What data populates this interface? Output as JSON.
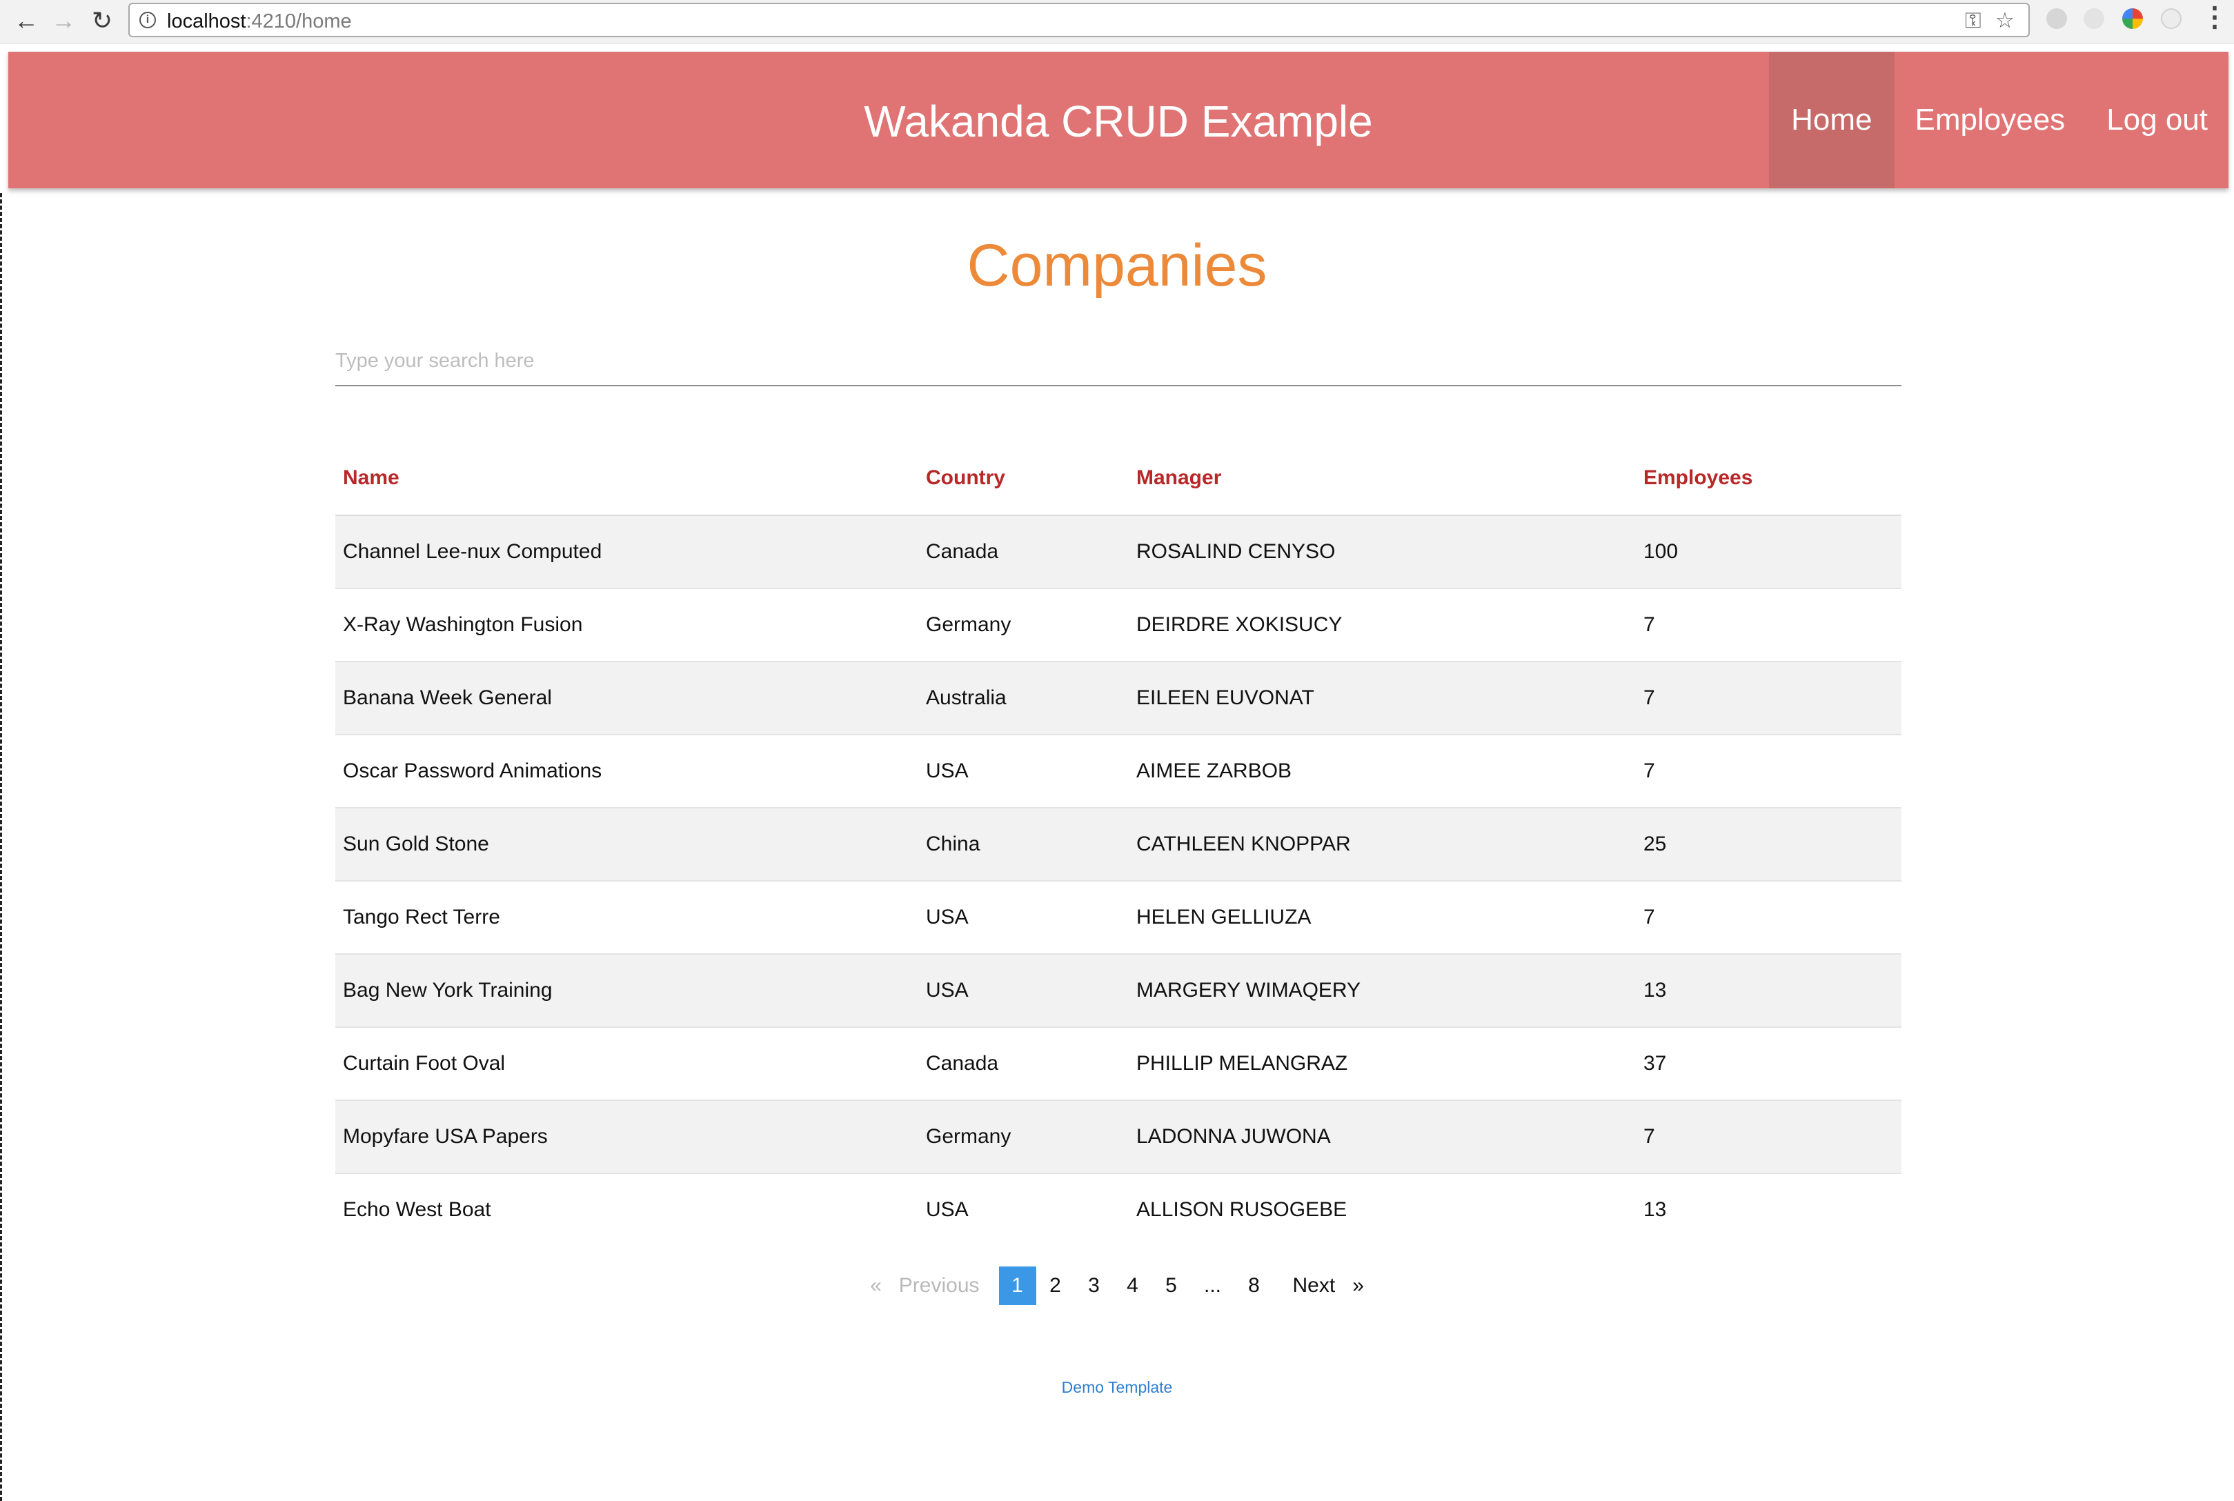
{
  "browser": {
    "url_host": "localhost",
    "url_rest": ":4210/home"
  },
  "app": {
    "title": "Wakanda CRUD Example",
    "nav": [
      {
        "label": "Home",
        "active": true
      },
      {
        "label": "Employees",
        "active": false
      },
      {
        "label": "Log out",
        "active": false
      }
    ]
  },
  "page": {
    "title": "Companies",
    "search_placeholder": "Type your search here"
  },
  "table": {
    "headers": [
      "Name",
      "Country",
      "Manager",
      "Employees"
    ],
    "rows": [
      [
        "Channel Lee-nux Computed",
        "Canada",
        "ROSALIND CENYSO",
        "100"
      ],
      [
        "X-Ray Washington Fusion",
        "Germany",
        "DEIRDRE XOKISUCY",
        "7"
      ],
      [
        "Banana Week General",
        "Australia",
        "EILEEN EUVONAT",
        "7"
      ],
      [
        "Oscar Password Animations",
        "USA",
        "AIMEE ZARBOB",
        "7"
      ],
      [
        "Sun Gold Stone",
        "China",
        "CATHLEEN KNOPPAR",
        "25"
      ],
      [
        "Tango Rect Terre",
        "USA",
        "HELEN GELLIUZA",
        "7"
      ],
      [
        "Bag New York Training",
        "USA",
        "MARGERY WIMAQERY",
        "13"
      ],
      [
        "Curtain Foot Oval",
        "Canada",
        "PHILLIP MELANGRAZ",
        "37"
      ],
      [
        "Mopyfare USA Papers",
        "Germany",
        "LADONNA JUWONA",
        "7"
      ],
      [
        "Echo West Boat",
        "USA",
        "ALLISON RUSOGEBE",
        "13"
      ]
    ]
  },
  "pagination": {
    "previous": "«   Previous",
    "next": "Next   »",
    "pages": [
      "1",
      "2",
      "3",
      "4",
      "5",
      "...",
      "8"
    ],
    "current": "1"
  },
  "footer": {
    "link": "Demo Template"
  },
  "colors": {
    "appbar": "#e07474",
    "active_nav": "#c76a6a",
    "page_title": "#ec8a3a",
    "table_header": "#b82828",
    "pager_current": "#3a98e6",
    "footer_link": "#2f7fd0"
  }
}
